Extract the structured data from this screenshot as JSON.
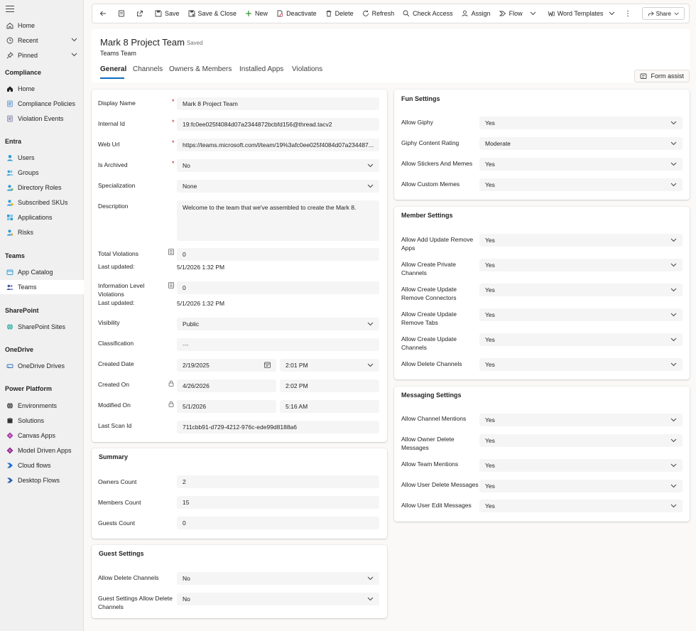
{
  "sidebar": {
    "home": "Home",
    "recent": "Recent",
    "pinned": "Pinned",
    "sections": {
      "compliance": "Compliance",
      "entra": "Entra",
      "teams": "Teams",
      "sharepoint": "SharePoint",
      "onedrive": "OneDrive",
      "powerplatform": "Power Platform"
    },
    "compliance_items": [
      "Home",
      "Compliance Policies",
      "Violation Events"
    ],
    "entra_items": [
      "Users",
      "Groups",
      "Directory Roles",
      "Subscribed SKUs",
      "Applications",
      "Risks"
    ],
    "teams_items": [
      "App Catalog",
      "Teams"
    ],
    "sharepoint_items": [
      "SharePoint Sites"
    ],
    "onedrive_items": [
      "OneDrive Drives"
    ],
    "powerplatform_items": [
      "Environments",
      "Solutions",
      "Canvas Apps",
      "Model Driven Apps",
      "Cloud flows",
      "Desktop Flows"
    ]
  },
  "toolbar": {
    "save": "Save",
    "save_close": "Save & Close",
    "new": "New",
    "deactivate": "Deactivate",
    "delete": "Delete",
    "refresh": "Refresh",
    "check_access": "Check Access",
    "assign": "Assign",
    "flow": "Flow",
    "word_templates": "Word Templates",
    "share": "Share"
  },
  "header": {
    "title": "Mark 8 Project Team",
    "saved": "- Saved",
    "subtitle": "Teams Team",
    "tabs": [
      "General",
      "Channels",
      "Owners & Members",
      "Installed Apps",
      "Violations"
    ],
    "form_assist": "Form assist"
  },
  "general": {
    "display_name_label": "Display Name",
    "display_name": "Mark 8 Project Team",
    "internal_id_label": "Internal Id",
    "internal_id": "19:fc0ee025f4084d07a2344872bcbfd156@thread.tacv2",
    "web_url_label": "Web Url",
    "web_url": "https://teams.microsoft.com/l/team/19%3afc0ee025f4084d07a234487...",
    "is_archived_label": "Is Archived",
    "is_archived": "No",
    "specialization_label": "Specialization",
    "specialization": "None",
    "description_label": "Description",
    "description": "Welcome to the team that we've assembled to create the Mark 8.",
    "total_violations_label": "Total Violations",
    "total_violations": "0",
    "last_updated_label": "Last updated:",
    "total_violations_updated": "5/1/2026 1:32 PM",
    "info_violations_label_1": "Information Level",
    "info_violations_label_2": "Violations",
    "info_violations": "0",
    "info_violations_updated": "5/1/2026 1:32 PM",
    "visibility_label": "Visibility",
    "visibility": "Public",
    "classification_label": "Classification",
    "classification": "---",
    "created_date_label": "Created Date",
    "created_date": "2/19/2025",
    "created_time": "2:01 PM",
    "created_on_label": "Created On",
    "created_on_date": "4/26/2026",
    "created_on_time": "2:02 PM",
    "modified_on_label": "Modified On",
    "modified_on_date": "5/1/2026",
    "modified_on_time": "5:16 AM",
    "last_scan_label": "Last Scan Id",
    "last_scan": "711cbb91-d729-4212-976c-ede99d8188a6"
  },
  "summary": {
    "title": "Summary",
    "owners_label": "Owners Count",
    "owners": "2",
    "members_label": "Members Count",
    "members": "15",
    "guests_label": "Guests Count",
    "guests": "0"
  },
  "guest": {
    "title": "Guest Settings",
    "allow_delete_label": "Allow Delete Channels",
    "allow_delete": "No",
    "guest_allow_delete_label_1": "Guest Settings Allow Delete",
    "guest_allow_delete_label_2": "Channels",
    "guest_allow_delete": "No"
  },
  "fun": {
    "title": "Fun Settings",
    "giphy_label": "Allow Giphy",
    "giphy": "Yes",
    "rating_label": "Giphy Content Rating",
    "rating": "Moderate",
    "stickers_label": "Allow Stickers And Memes",
    "stickers": "Yes",
    "custom_label": "Allow Custom Memes",
    "custom": "Yes"
  },
  "member": {
    "title": "Member Settings",
    "add_update_remove_apps_1": "Allow Add Update Remove",
    "add_update_remove_apps_2": "Apps",
    "add_update_remove_apps": "Yes",
    "create_private_1": "Allow Create Private",
    "create_private_2": "Channels",
    "create_private": "Yes",
    "connectors_1": "Allow Create Update",
    "connectors_2": "Remove Connectors",
    "connectors": "Yes",
    "tabs_1": "Allow Create Update",
    "tabs_2": "Remove Tabs",
    "tabs": "Yes",
    "channels_1": "Allow Create Update",
    "channels_2": "Channels",
    "channels": "Yes",
    "delete_channels_label": "Allow Delete Channels",
    "delete_channels": "Yes"
  },
  "messaging": {
    "title": "Messaging Settings",
    "channel_mentions_label": "Allow Channel Mentions",
    "channel_mentions": "Yes",
    "owner_delete_1": "Allow Owner Delete",
    "owner_delete_2": "Messages",
    "owner_delete": "Yes",
    "team_mentions_label": "Allow Team Mentions",
    "team_mentions": "Yes",
    "user_delete_label": "Allow User Delete Messages",
    "user_delete": "Yes",
    "user_edit_label": "Allow User Edit Messages",
    "user_edit": "Yes"
  },
  "colors": {
    "accent": "#0f6cbd",
    "required": "#c50f1f"
  }
}
